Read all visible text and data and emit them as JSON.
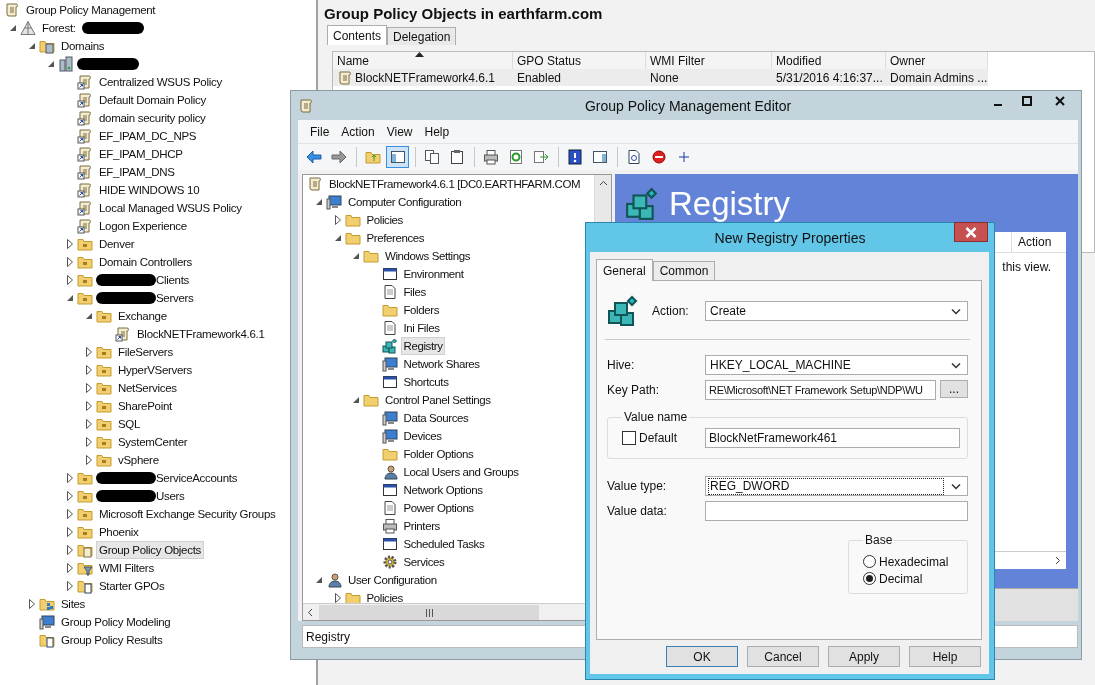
{
  "gpmc_tree": {
    "label": "Group Policy Management",
    "kind": "console",
    "selected": false,
    "children": [
      {
        "label": "Forest:",
        "redacted_after": true,
        "kind": "forest",
        "expanded": true,
        "selected": false,
        "children": [
          {
            "label": "Domains",
            "kind": "domains",
            "expanded": true,
            "selected": false,
            "children": [
              {
                "redacted_after": true,
                "kind": "domain",
                "expanded": true,
                "children": [
                  {
                    "label": "Centralized WSUS Policy",
                    "kind": "gpo-link",
                    "selected": false
                  },
                  {
                    "label": "Default Domain Policy",
                    "kind": "gpo-link",
                    "selected": false
                  },
                  {
                    "label": "domain security policy",
                    "kind": "gpo-link",
                    "selected": false
                  },
                  {
                    "label": "EF_IPAM_DC_NPS",
                    "kind": "gpo-link",
                    "selected": false
                  },
                  {
                    "label": "EF_IPAM_DHCP",
                    "kind": "gpo-link",
                    "selected": false
                  },
                  {
                    "label": "EF_IPAM_DNS",
                    "kind": "gpo-link",
                    "selected": false
                  },
                  {
                    "label": "HIDE WINDOWS 10",
                    "kind": "gpo-link",
                    "selected": false
                  },
                  {
                    "label": "Local Managed WSUS Policy",
                    "kind": "gpo-link",
                    "selected": false
                  },
                  {
                    "label": "Logon Experience",
                    "kind": "gpo-link",
                    "selected": false
                  },
                  {
                    "label": "Denver",
                    "kind": "ou",
                    "expanded": false,
                    "selected": false
                  },
                  {
                    "label": "Domain Controllers",
                    "kind": "ou",
                    "expanded": false,
                    "selected": false
                  },
                  {
                    "label": "Clients",
                    "redacted_before": true,
                    "kind": "ou",
                    "expanded": false,
                    "selected": false
                  },
                  {
                    "label": "Servers",
                    "redacted_before": true,
                    "kind": "ou",
                    "expanded": true,
                    "selected": false,
                    "children": [
                      {
                        "label": "Exchange",
                        "kind": "ou",
                        "expanded": true,
                        "selected": false,
                        "children": [
                          {
                            "label": "BlockNETFramework4.6.1",
                            "kind": "gpo-link",
                            "selected": false
                          }
                        ]
                      },
                      {
                        "label": "FileServers",
                        "kind": "ou",
                        "expanded": false,
                        "selected": false
                      },
                      {
                        "label": "HyperVServers",
                        "kind": "ou",
                        "expanded": false,
                        "selected": false
                      },
                      {
                        "label": "NetServices",
                        "kind": "ou",
                        "expanded": false,
                        "selected": false
                      },
                      {
                        "label": "SharePoint",
                        "kind": "ou",
                        "expanded": false,
                        "selected": false
                      },
                      {
                        "label": "SQL",
                        "kind": "ou",
                        "expanded": false,
                        "selected": false
                      },
                      {
                        "label": "SystemCenter",
                        "kind": "ou",
                        "expanded": false,
                        "selected": false
                      },
                      {
                        "label": "vSphere",
                        "kind": "ou",
                        "expanded": false,
                        "selected": false
                      }
                    ]
                  },
                  {
                    "label": "ServiceAccounts",
                    "redacted_before": true,
                    "kind": "ou",
                    "expanded": false,
                    "selected": false
                  },
                  {
                    "label": "Users",
                    "redacted_before": true,
                    "kind": "ou",
                    "expanded": false,
                    "selected": false
                  },
                  {
                    "label": "Microsoft Exchange Security Groups",
                    "kind": "ou",
                    "expanded": false,
                    "selected": false
                  },
                  {
                    "label": "Phoenix",
                    "kind": "ou",
                    "expanded": false,
                    "selected": false
                  },
                  {
                    "label": "Group Policy Objects",
                    "kind": "gpo-folder",
                    "expanded": false,
                    "selected": true
                  },
                  {
                    "label": "WMI Filters",
                    "kind": "wmi-folder",
                    "expanded": false,
                    "selected": false
                  },
                  {
                    "label": "Starter GPOs",
                    "kind": "starter-folder",
                    "expanded": false,
                    "selected": false
                  }
                ]
              }
            ]
          },
          {
            "label": "Sites",
            "kind": "sites",
            "expanded": false,
            "selected": false
          },
          {
            "label": "Group Policy Modeling",
            "kind": "modeling",
            "selected": false
          },
          {
            "label": "Group Policy Results",
            "kind": "results",
            "selected": false
          }
        ]
      }
    ]
  },
  "gpo_panel": {
    "title": "Group Policy Objects in earthfarm.com",
    "tabs": [
      {
        "label": "Contents",
        "selected": true
      },
      {
        "label": "Delegation",
        "selected": false
      }
    ],
    "columns": [
      {
        "label": "Name",
        "sorted": true
      },
      {
        "label": "GPO Status",
        "sorted": false
      },
      {
        "label": "WMI Filter",
        "sorted": false
      },
      {
        "label": "Modified",
        "sorted": false
      },
      {
        "label": "Owner",
        "sorted": false
      }
    ],
    "rows": [
      {
        "cells": [
          "BlockNETFramework4.6.1",
          "Enabled",
          "None",
          "5/31/2016 4:16:37...",
          "Domain Admins ..."
        ],
        "selected": true
      }
    ]
  },
  "editor": {
    "title": "Group Policy Management Editor",
    "menu": [
      "File",
      "Action",
      "View",
      "Help"
    ],
    "toolbar": [
      {
        "kind": "back",
        "on": false
      },
      {
        "kind": "forward",
        "on": false
      },
      {
        "kind": "separator"
      },
      {
        "kind": "up",
        "on": false
      },
      {
        "kind": "console-tree",
        "on": true
      },
      {
        "kind": "separator"
      },
      {
        "kind": "copy",
        "on": false
      },
      {
        "kind": "paste",
        "on": false
      },
      {
        "kind": "separator"
      },
      {
        "kind": "print",
        "on": false
      },
      {
        "kind": "refresh",
        "on": false
      },
      {
        "kind": "export",
        "on": false
      },
      {
        "kind": "separator"
      },
      {
        "kind": "help",
        "on": false
      },
      {
        "kind": "show-pane",
        "on": false
      },
      {
        "kind": "separator"
      },
      {
        "kind": "properties",
        "on": false
      },
      {
        "kind": "stop",
        "on": false
      },
      {
        "kind": "add",
        "on": false
      }
    ],
    "tree": {
      "label": "BlockNETFramework4.6.1 [DC0.EARTHFARM.COM",
      "kind": "gpo",
      "selected": false,
      "children": [
        {
          "label": "Computer Configuration",
          "kind": "computer",
          "expanded": true,
          "selected": false,
          "children": [
            {
              "label": "Policies",
              "kind": "folder",
              "expanded": false,
              "selected": false
            },
            {
              "label": "Preferences",
              "kind": "folder",
              "expanded": true,
              "selected": false,
              "children": [
                {
                  "label": "Windows Settings",
                  "kind": "folder",
                  "expanded": true,
                  "selected": false,
                  "children": [
                    {
                      "label": "Environment",
                      "kind": "window",
                      "selected": false
                    },
                    {
                      "label": "Files",
                      "kind": "document",
                      "selected": false
                    },
                    {
                      "label": "Folders",
                      "kind": "folder",
                      "selected": false
                    },
                    {
                      "label": "Ini Files",
                      "kind": "document",
                      "selected": false
                    },
                    {
                      "label": "Registry",
                      "kind": "registry",
                      "selected": true
                    },
                    {
                      "label": "Network Shares",
                      "kind": "computer",
                      "selected": false
                    },
                    {
                      "label": "Shortcuts",
                      "kind": "window",
                      "selected": false
                    }
                  ]
                },
                {
                  "label": "Control Panel Settings",
                  "kind": "folder",
                  "expanded": true,
                  "selected": false,
                  "children": [
                    {
                      "label": "Data Sources",
                      "kind": "computer",
                      "selected": false
                    },
                    {
                      "label": "Devices",
                      "kind": "computer",
                      "selected": false
                    },
                    {
                      "label": "Folder Options",
                      "kind": "folder",
                      "selected": false
                    },
                    {
                      "label": "Local Users and Groups",
                      "kind": "user",
                      "selected": false
                    },
                    {
                      "label": "Network Options",
                      "kind": "window",
                      "selected": false
                    },
                    {
                      "label": "Power Options",
                      "kind": "document",
                      "selected": false
                    },
                    {
                      "label": "Printers",
                      "kind": "printer",
                      "selected": false
                    },
                    {
                      "label": "Scheduled Tasks",
                      "kind": "window",
                      "selected": false
                    },
                    {
                      "label": "Services",
                      "kind": "gear",
                      "selected": false
                    }
                  ]
                }
              ]
            }
          ]
        },
        {
          "label": "User Configuration",
          "kind": "user",
          "expanded": true,
          "selected": false,
          "children": [
            {
              "label": "Policies",
              "kind": "folder",
              "expanded": false,
              "selected": false
            }
          ]
        }
      ]
    },
    "pane": {
      "heading": "Registry",
      "column": "Action",
      "message": "this view."
    },
    "status": "Registry"
  },
  "dialog": {
    "title": "New Registry Properties",
    "tabs": [
      {
        "label": "General",
        "selected": true
      },
      {
        "label": "Common",
        "selected": false
      }
    ],
    "action": {
      "label": "Action:",
      "value": "Create"
    },
    "hive": {
      "label": "Hive:",
      "value": "HKEY_LOCAL_MACHINE"
    },
    "key_path": {
      "label": "Key Path:",
      "value": "RE\\Microsoft\\NET Framework Setup\\NDP\\WU",
      "browse": "..."
    },
    "value_name": {
      "legend": "Value name",
      "default": {
        "label": "Default",
        "checked": false
      },
      "value": "BlockNetFramework461"
    },
    "value_type": {
      "label": "Value type:",
      "value": "REG_DWORD",
      "focused": true
    },
    "value_data": {
      "label": "Value data:"
    },
    "base": {
      "legend": "Base",
      "options": [
        {
          "label": "Hexadecimal",
          "selected": false
        },
        {
          "label": "Decimal",
          "selected": true
        }
      ]
    },
    "buttons": [
      {
        "label": "OK",
        "default": true
      },
      {
        "label": "Cancel",
        "default": false
      },
      {
        "label": "Apply",
        "default": false
      },
      {
        "label": "Help",
        "default": false
      }
    ]
  }
}
